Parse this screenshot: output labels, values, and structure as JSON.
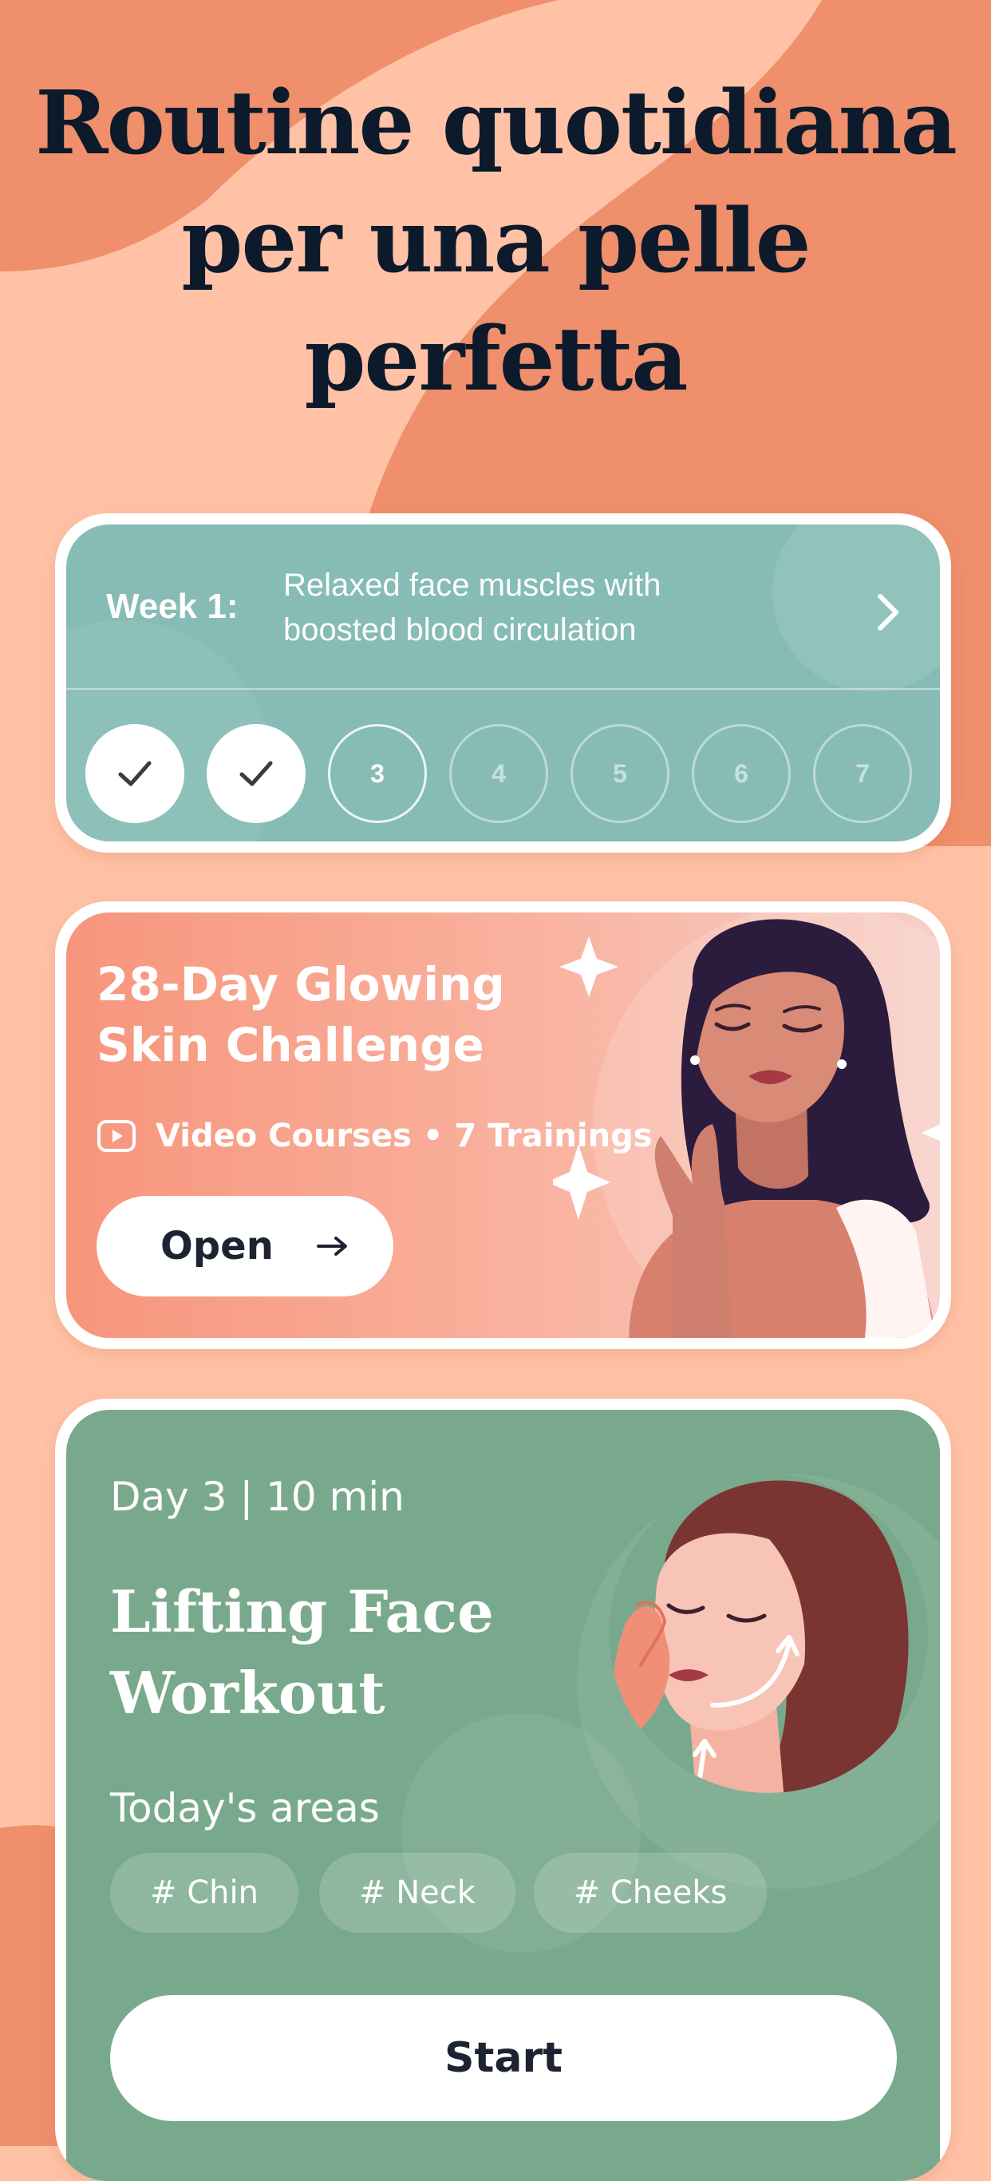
{
  "headline": "Routine quotidiana per una pelle perfetta",
  "colors": {
    "background": "#ffc2a6",
    "blob": "#ef8f6b",
    "headline": "#0c1a2b",
    "week_card": "#86bcb5",
    "challenge_card_start": "#f7957c",
    "workout_card": "#79a98c"
  },
  "week_card": {
    "title": "Week 1:",
    "description": "Relaxed face muscles with boosted blood circulation",
    "chevron_icon": "chevron-right-icon",
    "days": [
      {
        "label": "",
        "state": "done",
        "icon": "check-icon"
      },
      {
        "label": "",
        "state": "done",
        "icon": "check-icon"
      },
      {
        "label": "3",
        "state": "current"
      },
      {
        "label": "4",
        "state": "future"
      },
      {
        "label": "5",
        "state": "future"
      },
      {
        "label": "6",
        "state": "future"
      },
      {
        "label": "7",
        "state": "future"
      }
    ]
  },
  "challenge_card": {
    "title": "28-Day Glowing Skin Challenge",
    "icon": "video-play-icon",
    "meta": "Video Courses • 7 Trainings",
    "button_label": "Open",
    "button_icon": "arrow-right-icon"
  },
  "workout_card": {
    "meta": "Day 3 | 10 min",
    "title": "Lifting Face Workout",
    "areas_label": "Today's areas",
    "areas": [
      "# Chin",
      "# Neck",
      "# Cheeks"
    ],
    "button_label": "Start"
  }
}
